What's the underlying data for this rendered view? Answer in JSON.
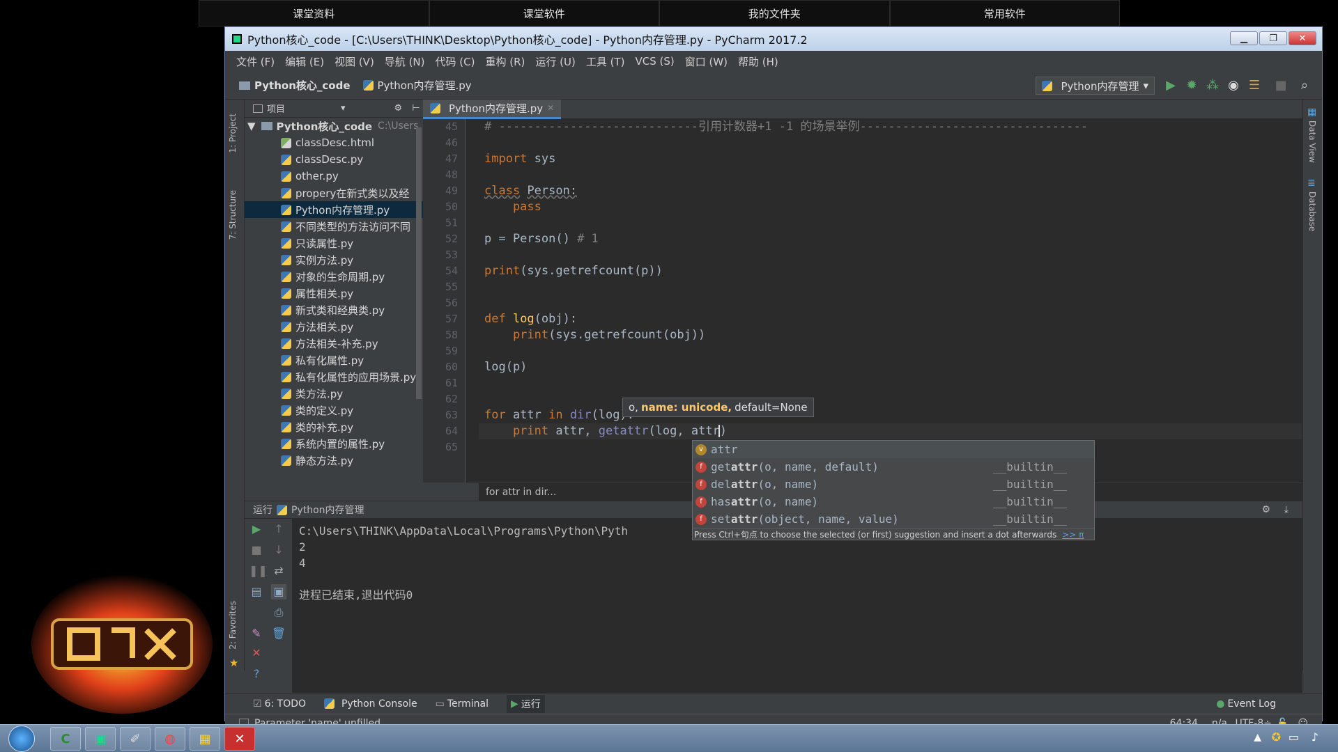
{
  "top_tabs": [
    "课堂资料",
    "课堂软件",
    "我的文件夹",
    "常用软件"
  ],
  "window": {
    "title": "Python核心_code - [C:\\Users\\THINK\\Desktop\\Python核心_code] - Python内存管理.py - PyCharm 2017.2",
    "controls": [
      "▁",
      "❐",
      "✕"
    ]
  },
  "menu": [
    "文件 (F)",
    "编辑 (E)",
    "视图 (V)",
    "导航 (N)",
    "代码 (C)",
    "重构 (R)",
    "运行 (U)",
    "工具 (T)",
    "VCS (S)",
    "窗口 (W)",
    "帮助 (H)"
  ],
  "navbar": {
    "project": "Python核心_code",
    "file": "Python内存管理.py",
    "run_config": "Python内存管理"
  },
  "left_strip": [
    "1: Project",
    "7: Structure",
    "2: Favorites"
  ],
  "right_strip": [
    "Data View",
    "Database"
  ],
  "project_panel": {
    "header": "项目",
    "root": "Python核心_code",
    "root_path": "C:\\Users",
    "files": [
      {
        "name": "classDesc.html",
        "type": "html"
      },
      {
        "name": "classDesc.py",
        "type": "py"
      },
      {
        "name": "other.py",
        "type": "py"
      },
      {
        "name": "propery在新式类以及经",
        "type": "py"
      },
      {
        "name": "Python内存管理.py",
        "type": "py",
        "selected": true
      },
      {
        "name": "不同类型的方法访问不同",
        "type": "py"
      },
      {
        "name": "只读属性.py",
        "type": "py"
      },
      {
        "name": "实例方法.py",
        "type": "py"
      },
      {
        "name": "对象的生命周期.py",
        "type": "py"
      },
      {
        "name": "属性相关.py",
        "type": "py"
      },
      {
        "name": "新式类和经典类.py",
        "type": "py"
      },
      {
        "name": "方法相关.py",
        "type": "py"
      },
      {
        "name": "方法相关-补充.py",
        "type": "py"
      },
      {
        "name": "私有化属性.py",
        "type": "py"
      },
      {
        "name": "私有化属性的应用场景.py",
        "type": "py"
      },
      {
        "name": "类方法.py",
        "type": "py"
      },
      {
        "name": "类的定义.py",
        "type": "py"
      },
      {
        "name": "类的补充.py",
        "type": "py"
      },
      {
        "name": "系统内置的属性.py",
        "type": "py"
      },
      {
        "name": "静态方法.py",
        "type": "py"
      }
    ]
  },
  "editor": {
    "tab": "Python内存管理.py",
    "line_numbers": [
      "45",
      "46",
      "47",
      "48",
      "49",
      "50",
      "51",
      "52",
      "53",
      "54",
      "55",
      "56",
      "57",
      "58",
      "59",
      "60",
      "61",
      "62",
      "63",
      "64",
      "65"
    ],
    "lines": [
      [
        {
          "t": "# ----------------------------引用计数器+1 -1 的场景举例--------------------------------",
          "c": "cm"
        }
      ],
      [],
      [
        {
          "t": "import",
          "c": "kw"
        },
        {
          "t": " sys",
          "c": ""
        }
      ],
      [],
      [
        {
          "t": "class",
          "c": "kw ul"
        },
        {
          "t": " ",
          "c": ""
        },
        {
          "t": "Person:",
          "c": "ul"
        }
      ],
      [
        {
          "t": "    pass",
          "c": "kw"
        }
      ],
      [],
      [
        {
          "t": "p = Person() ",
          "c": ""
        },
        {
          "t": "# 1",
          "c": "cm"
        }
      ],
      [],
      [
        {
          "t": "print",
          "c": "kw"
        },
        {
          "t": "(sys.getrefcount(p))",
          "c": ""
        }
      ],
      [],
      [],
      [
        {
          "t": "def ",
          "c": "kw"
        },
        {
          "t": "log",
          "c": "fn"
        },
        {
          "t": "(obj):",
          "c": ""
        }
      ],
      [
        {
          "t": "    print",
          "c": "kw"
        },
        {
          "t": "(sys.getrefcount(obj))",
          "c": ""
        }
      ],
      [],
      [
        {
          "t": "log(p)",
          "c": ""
        }
      ],
      [],
      [],
      [
        {
          "t": "for ",
          "c": "kw"
        },
        {
          "t": "attr ",
          "c": ""
        },
        {
          "t": "in ",
          "c": "kw"
        },
        {
          "t": "dir",
          "c": "bi"
        },
        {
          "t": "(log):",
          "c": ""
        }
      ],
      [
        {
          "t": "    print ",
          "c": "kw"
        },
        {
          "t": "attr, ",
          "c": ""
        },
        {
          "t": "getattr",
          "c": "bi"
        },
        {
          "t": "(log, attr)",
          "c": ""
        }
      ],
      []
    ],
    "breadcrumb": "for attr in dir..."
  },
  "param_hint": {
    "pre": "o,",
    "bold": "name: unicode,",
    "post": "default=None"
  },
  "completion": {
    "items": [
      {
        "badge": "v",
        "match": "attr",
        "rest": "",
        "module": "",
        "color": "#b4882a"
      },
      {
        "badge": "f",
        "match": "get",
        "hl": "attr",
        "rest": "(o, name, default)",
        "module": "__builtin__",
        "color": "#c3443b"
      },
      {
        "badge": "f",
        "match": "del",
        "hl": "attr",
        "rest": "(o, name)",
        "module": "__builtin__",
        "color": "#c3443b"
      },
      {
        "badge": "f",
        "match": "has",
        "hl": "attr",
        "rest": "(o, name)",
        "module": "__builtin__",
        "color": "#c3443b"
      },
      {
        "badge": "f",
        "match": "set",
        "hl": "attr",
        "rest": "(object, name, value)",
        "module": "__builtin__",
        "color": "#c3443b"
      }
    ],
    "footer": "Press Ctrl+句点 to choose the selected (or first) suggestion and insert a dot afterwards",
    "footer_link": ">> π"
  },
  "run_panel": {
    "label": "运行",
    "config": "Python内存管理",
    "output": [
      "C:\\Users\\THINK\\AppData\\Local\\Programs\\Python\\Pyth                                                  de/Python内存管理.py",
      "2",
      "4",
      "",
      "进程已结束,退出代码0"
    ]
  },
  "bottom_tabs": [
    "6: TODO",
    "Python Console",
    "Terminal",
    "运行"
  ],
  "event_log": "Event Log",
  "status": {
    "message": "Parameter 'name' unfilled",
    "position": "64:34",
    "line_sep": "n/a",
    "encoding": "UTF-8÷"
  }
}
